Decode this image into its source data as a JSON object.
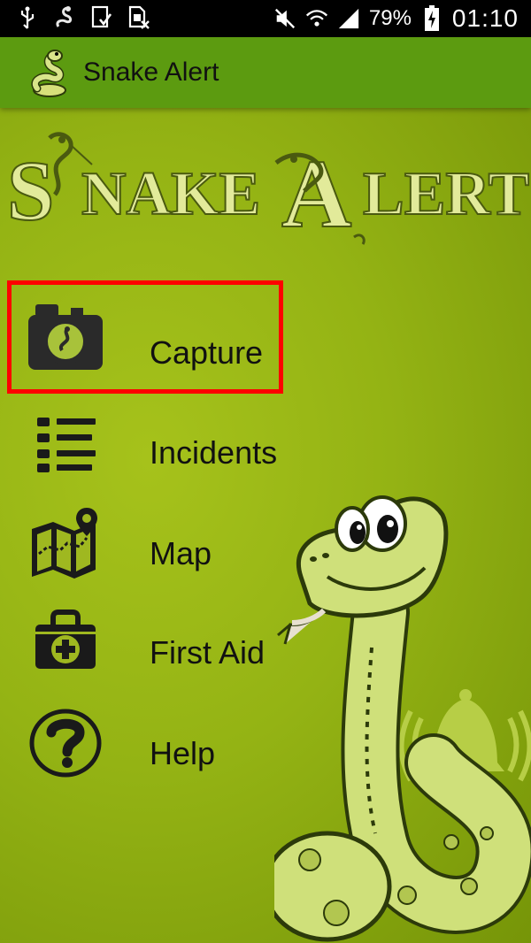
{
  "status_bar": {
    "battery_percent": "79%",
    "time": "01:10",
    "icons": [
      "usb-icon",
      "snake-notification-icon",
      "download-done-icon",
      "sim-card-icon",
      "mute-icon",
      "wifi-icon",
      "signal-icon",
      "battery-charging-icon"
    ]
  },
  "app_bar": {
    "title": "Snake Alert",
    "icon": "snake-logo-icon"
  },
  "banner": {
    "text": "Snake Alert"
  },
  "menu": [
    {
      "label": "Capture",
      "icon": "camera-icon"
    },
    {
      "label": "Incidents",
      "icon": "list-icon"
    },
    {
      "label": "Map",
      "icon": "map-icon"
    },
    {
      "label": "First Aid",
      "icon": "first-aid-kit-icon"
    },
    {
      "label": "Help",
      "icon": "help-icon"
    }
  ],
  "colors": {
    "app_bar": "#5c9b10",
    "background": "#94b314",
    "highlight": "#ff0000",
    "banner_text": "#e2ea9a"
  }
}
